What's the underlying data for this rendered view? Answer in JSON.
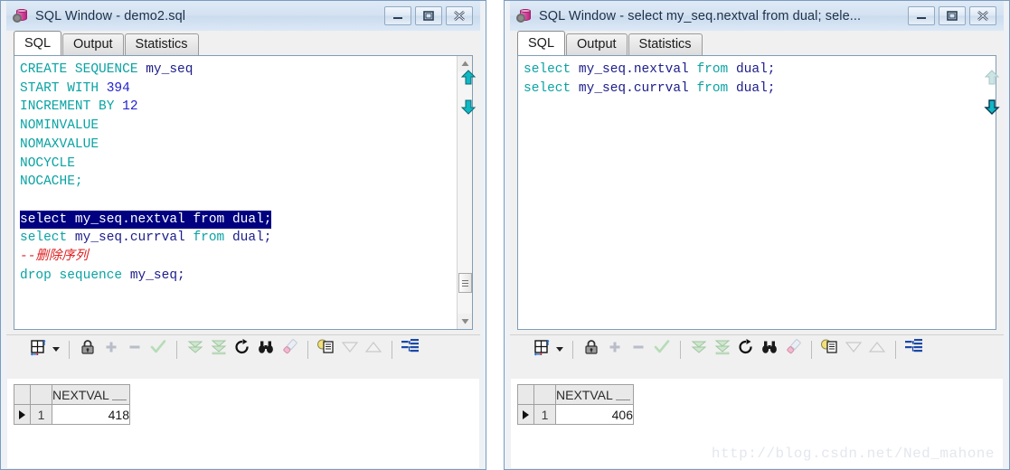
{
  "windows": {
    "left": {
      "title": "SQL Window - demo2.sql",
      "app_icon": "database-gear-icon",
      "caption_buttons": {
        "minimize": "minimize-icon",
        "maximize": "restore-icon",
        "close": "close-icon"
      },
      "tabs": [
        {
          "label": "SQL",
          "active": true
        },
        {
          "label": "Output",
          "active": false
        },
        {
          "label": "Statistics",
          "active": false
        }
      ],
      "editor": {
        "lines": [
          {
            "segments": [
              {
                "text": "CREATE SEQUENCE ",
                "cls": "kw"
              },
              {
                "text": "my_seq",
                "cls": "ident"
              }
            ]
          },
          {
            "segments": [
              {
                "text": "START WITH ",
                "cls": "kw"
              },
              {
                "text": "394",
                "cls": "num"
              }
            ]
          },
          {
            "segments": [
              {
                "text": "INCREMENT BY ",
                "cls": "kw"
              },
              {
                "text": "12",
                "cls": "num"
              }
            ]
          },
          {
            "segments": [
              {
                "text": "NOMINVALUE",
                "cls": "kw"
              }
            ]
          },
          {
            "segments": [
              {
                "text": "NOMAXVALUE",
                "cls": "kw"
              }
            ]
          },
          {
            "segments": [
              {
                "text": "NOCYCLE",
                "cls": "kw"
              }
            ]
          },
          {
            "segments": [
              {
                "text": "NOCACHE;",
                "cls": "kw"
              }
            ]
          },
          {
            "segments": []
          },
          {
            "selected": true,
            "segments": [
              {
                "text": "select ",
                "cls": "kw"
              },
              {
                "text": "my_seq.nextval ",
                "cls": "ident"
              },
              {
                "text": "from ",
                "cls": "kw"
              },
              {
                "text": "dual;",
                "cls": "ident"
              }
            ]
          },
          {
            "segments": [
              {
                "text": "select ",
                "cls": "kw"
              },
              {
                "text": "my_seq.currval ",
                "cls": "ident"
              },
              {
                "text": "from ",
                "cls": "kw"
              },
              {
                "text": "dual;",
                "cls": "ident"
              }
            ]
          },
          {
            "segments": [
              {
                "text": "--删除序列",
                "cls": "cmt"
              }
            ]
          },
          {
            "segments": [
              {
                "text": "drop sequence ",
                "cls": "kw"
              },
              {
                "text": "my_seq;",
                "cls": "ident"
              }
            ]
          }
        ]
      },
      "nav": {
        "up_icon": "nav-up-arrow-icon",
        "down_icon": "nav-down-arrow-icon",
        "up_enabled": true,
        "down_enabled": true
      },
      "scrollbar": {
        "visible": true,
        "up_icon": "scroll-up-icon",
        "down_icon": "scroll-down-icon",
        "thumb": "scroll-thumb"
      },
      "toolbar": [
        {
          "name": "grid-layout-button",
          "icon": "grid-icon",
          "enabled": true
        },
        {
          "name": "grid-layout-dropdown",
          "icon": "chevron-down-icon",
          "enabled": true
        },
        {
          "name": "separator-1",
          "icon": "separator",
          "enabled": false
        },
        {
          "name": "lock-button",
          "icon": "lock-icon",
          "enabled": true
        },
        {
          "name": "add-row-button",
          "icon": "plus-icon",
          "enabled": false
        },
        {
          "name": "delete-row-button",
          "icon": "minus-icon",
          "enabled": false
        },
        {
          "name": "commit-button",
          "icon": "check-icon",
          "enabled": false
        },
        {
          "name": "separator-2",
          "icon": "separator",
          "enabled": false
        },
        {
          "name": "fetch-next-page-button",
          "icon": "double-chevron-down-icon",
          "enabled": false
        },
        {
          "name": "fetch-last-page-button",
          "icon": "chevron-down-bar-icon",
          "enabled": false
        },
        {
          "name": "refresh-button",
          "icon": "refresh-icon",
          "enabled": true
        },
        {
          "name": "find-button",
          "icon": "binoculars-icon",
          "enabled": true
        },
        {
          "name": "clear-button",
          "icon": "eraser-icon",
          "enabled": false
        },
        {
          "name": "separator-3",
          "icon": "separator",
          "enabled": false
        },
        {
          "name": "copy-to-clipboard-button",
          "icon": "copy-notes-icon",
          "enabled": true
        },
        {
          "name": "sort-descending-button",
          "icon": "triangle-down-icon",
          "enabled": false
        },
        {
          "name": "sort-ascending-button",
          "icon": "triangle-up-icon",
          "enabled": false
        },
        {
          "name": "separator-4",
          "icon": "separator",
          "enabled": false
        },
        {
          "name": "explain-plan-button",
          "icon": "explain-plan-icon",
          "enabled": true
        }
      ],
      "result": {
        "columns": [
          "NEXTVAL"
        ],
        "rows": [
          {
            "num": "1",
            "values": [
              "418"
            ]
          }
        ]
      }
    },
    "right": {
      "title": "SQL Window - select my_seq.nextval from dual; sele...",
      "app_icon": "database-gear-icon",
      "caption_buttons": {
        "minimize": "minimize-icon",
        "maximize": "restore-icon",
        "close": "close-icon"
      },
      "tabs": [
        {
          "label": "SQL",
          "active": true
        },
        {
          "label": "Output",
          "active": false
        },
        {
          "label": "Statistics",
          "active": false
        }
      ],
      "editor": {
        "lines": [
          {
            "segments": [
              {
                "text": "select ",
                "cls": "kw"
              },
              {
                "text": "my_seq.nextval ",
                "cls": "ident"
              },
              {
                "text": "from ",
                "cls": "kw"
              },
              {
                "text": "dual;",
                "cls": "ident"
              }
            ]
          },
          {
            "segments": [
              {
                "text": "select ",
                "cls": "kw"
              },
              {
                "text": "my_seq.currval ",
                "cls": "ident"
              },
              {
                "text": "from ",
                "cls": "kw"
              },
              {
                "text": "dual;",
                "cls": "ident"
              }
            ]
          }
        ]
      },
      "nav": {
        "up_icon": "nav-up-arrow-icon",
        "down_icon": "nav-down-arrow-icon",
        "up_enabled": false,
        "down_enabled": true
      },
      "scrollbar": {
        "visible": false
      },
      "toolbar": [
        {
          "name": "grid-layout-button",
          "icon": "grid-icon",
          "enabled": true
        },
        {
          "name": "grid-layout-dropdown",
          "icon": "chevron-down-icon",
          "enabled": true
        },
        {
          "name": "separator-1",
          "icon": "separator",
          "enabled": false
        },
        {
          "name": "lock-button",
          "icon": "lock-icon",
          "enabled": true
        },
        {
          "name": "add-row-button",
          "icon": "plus-icon",
          "enabled": false
        },
        {
          "name": "delete-row-button",
          "icon": "minus-icon",
          "enabled": false
        },
        {
          "name": "commit-button",
          "icon": "check-icon",
          "enabled": false
        },
        {
          "name": "separator-2",
          "icon": "separator",
          "enabled": false
        },
        {
          "name": "fetch-next-page-button",
          "icon": "double-chevron-down-icon",
          "enabled": false
        },
        {
          "name": "fetch-last-page-button",
          "icon": "chevron-down-bar-icon",
          "enabled": false
        },
        {
          "name": "refresh-button",
          "icon": "refresh-icon",
          "enabled": true
        },
        {
          "name": "find-button",
          "icon": "binoculars-icon",
          "enabled": true
        },
        {
          "name": "clear-button",
          "icon": "eraser-icon",
          "enabled": false
        },
        {
          "name": "separator-3",
          "icon": "separator",
          "enabled": false
        },
        {
          "name": "copy-to-clipboard-button",
          "icon": "copy-notes-icon",
          "enabled": true
        },
        {
          "name": "sort-descending-button",
          "icon": "triangle-down-icon",
          "enabled": false
        },
        {
          "name": "sort-ascending-button",
          "icon": "triangle-up-icon",
          "enabled": false
        },
        {
          "name": "separator-4",
          "icon": "separator",
          "enabled": false
        },
        {
          "name": "explain-plan-button",
          "icon": "explain-plan-icon",
          "enabled": true
        }
      ],
      "result": {
        "columns": [
          "NEXTVAL"
        ],
        "rows": [
          {
            "num": "1",
            "values": [
              "406"
            ]
          }
        ]
      }
    }
  },
  "watermark": "http://blog.csdn.net/Ned_mahone",
  "colors": {
    "keyword": "#0aa3a3",
    "identifier": "#1c1c8c",
    "number": "#2222cc",
    "comment": "#e02020",
    "selection_bg": "#000080",
    "titlebar": "#d3e1f1"
  }
}
